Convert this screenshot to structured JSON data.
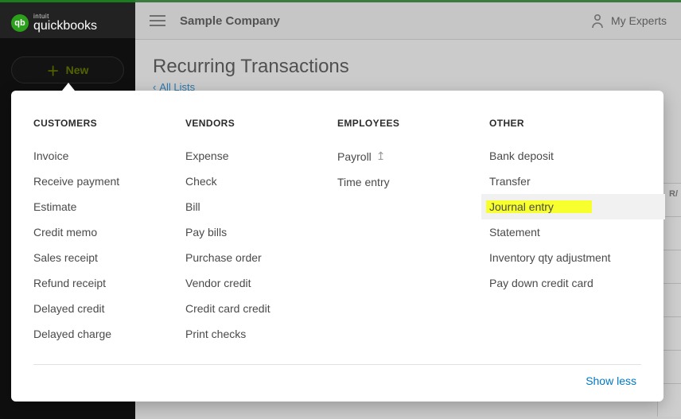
{
  "brand": {
    "mark": "qb",
    "intuit": "intuit",
    "product": "quickbooks"
  },
  "sidebar": {
    "new_label": "New"
  },
  "topbar": {
    "company": "Sample Company",
    "my_experts": "My Experts"
  },
  "page": {
    "title": "Recurring Transactions",
    "back": "All Lists"
  },
  "grid": {
    "head": "R/"
  },
  "flyout": {
    "show_less": "Show less",
    "customers": {
      "header": "CUSTOMERS",
      "items": [
        "Invoice",
        "Receive payment",
        "Estimate",
        "Credit memo",
        "Sales receipt",
        "Refund receipt",
        "Delayed credit",
        "Delayed charge"
      ]
    },
    "vendors": {
      "header": "VENDORS",
      "items": [
        "Expense",
        "Check",
        "Bill",
        "Pay bills",
        "Purchase order",
        "Vendor credit",
        "Credit card credit",
        "Print checks"
      ]
    },
    "employees": {
      "header": "EMPLOYEES",
      "items": [
        "Payroll",
        "Time entry"
      ]
    },
    "other": {
      "header": "OTHER",
      "items": [
        "Bank deposit",
        "Transfer",
        "Journal entry",
        "Statement",
        "Inventory qty adjustment",
        "Pay down credit card"
      ],
      "highlight_index": 2
    }
  }
}
